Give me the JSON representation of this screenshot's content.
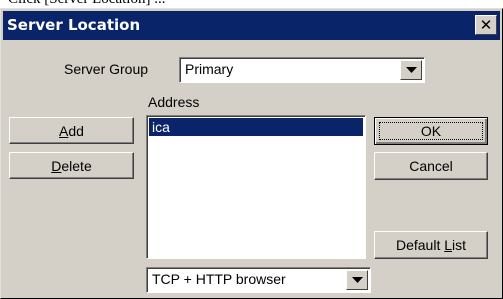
{
  "top_strip": {
    "text": "Click [Server Location] ..."
  },
  "dialog": {
    "title": "Server Location",
    "close_glyph": "✕"
  },
  "server_group": {
    "label": "Server Group",
    "value": "Primary"
  },
  "address": {
    "label": "Address",
    "items": [
      {
        "label": "ica",
        "selected": true
      }
    ]
  },
  "buttons": {
    "add": {
      "mnemonic": "A",
      "rest": "dd"
    },
    "delete": {
      "mnemonic": "D",
      "rest": "elete"
    },
    "ok": {
      "label": "OK"
    },
    "cancel": {
      "label": "Cancel"
    },
    "default_list": {
      "prefix": "Default ",
      "mnemonic": "L",
      "rest": "ist"
    }
  },
  "protocol": {
    "value": "TCP + HTTP browser"
  },
  "icons": {
    "close": "close-icon",
    "dropdown": "chevron-down-icon"
  }
}
